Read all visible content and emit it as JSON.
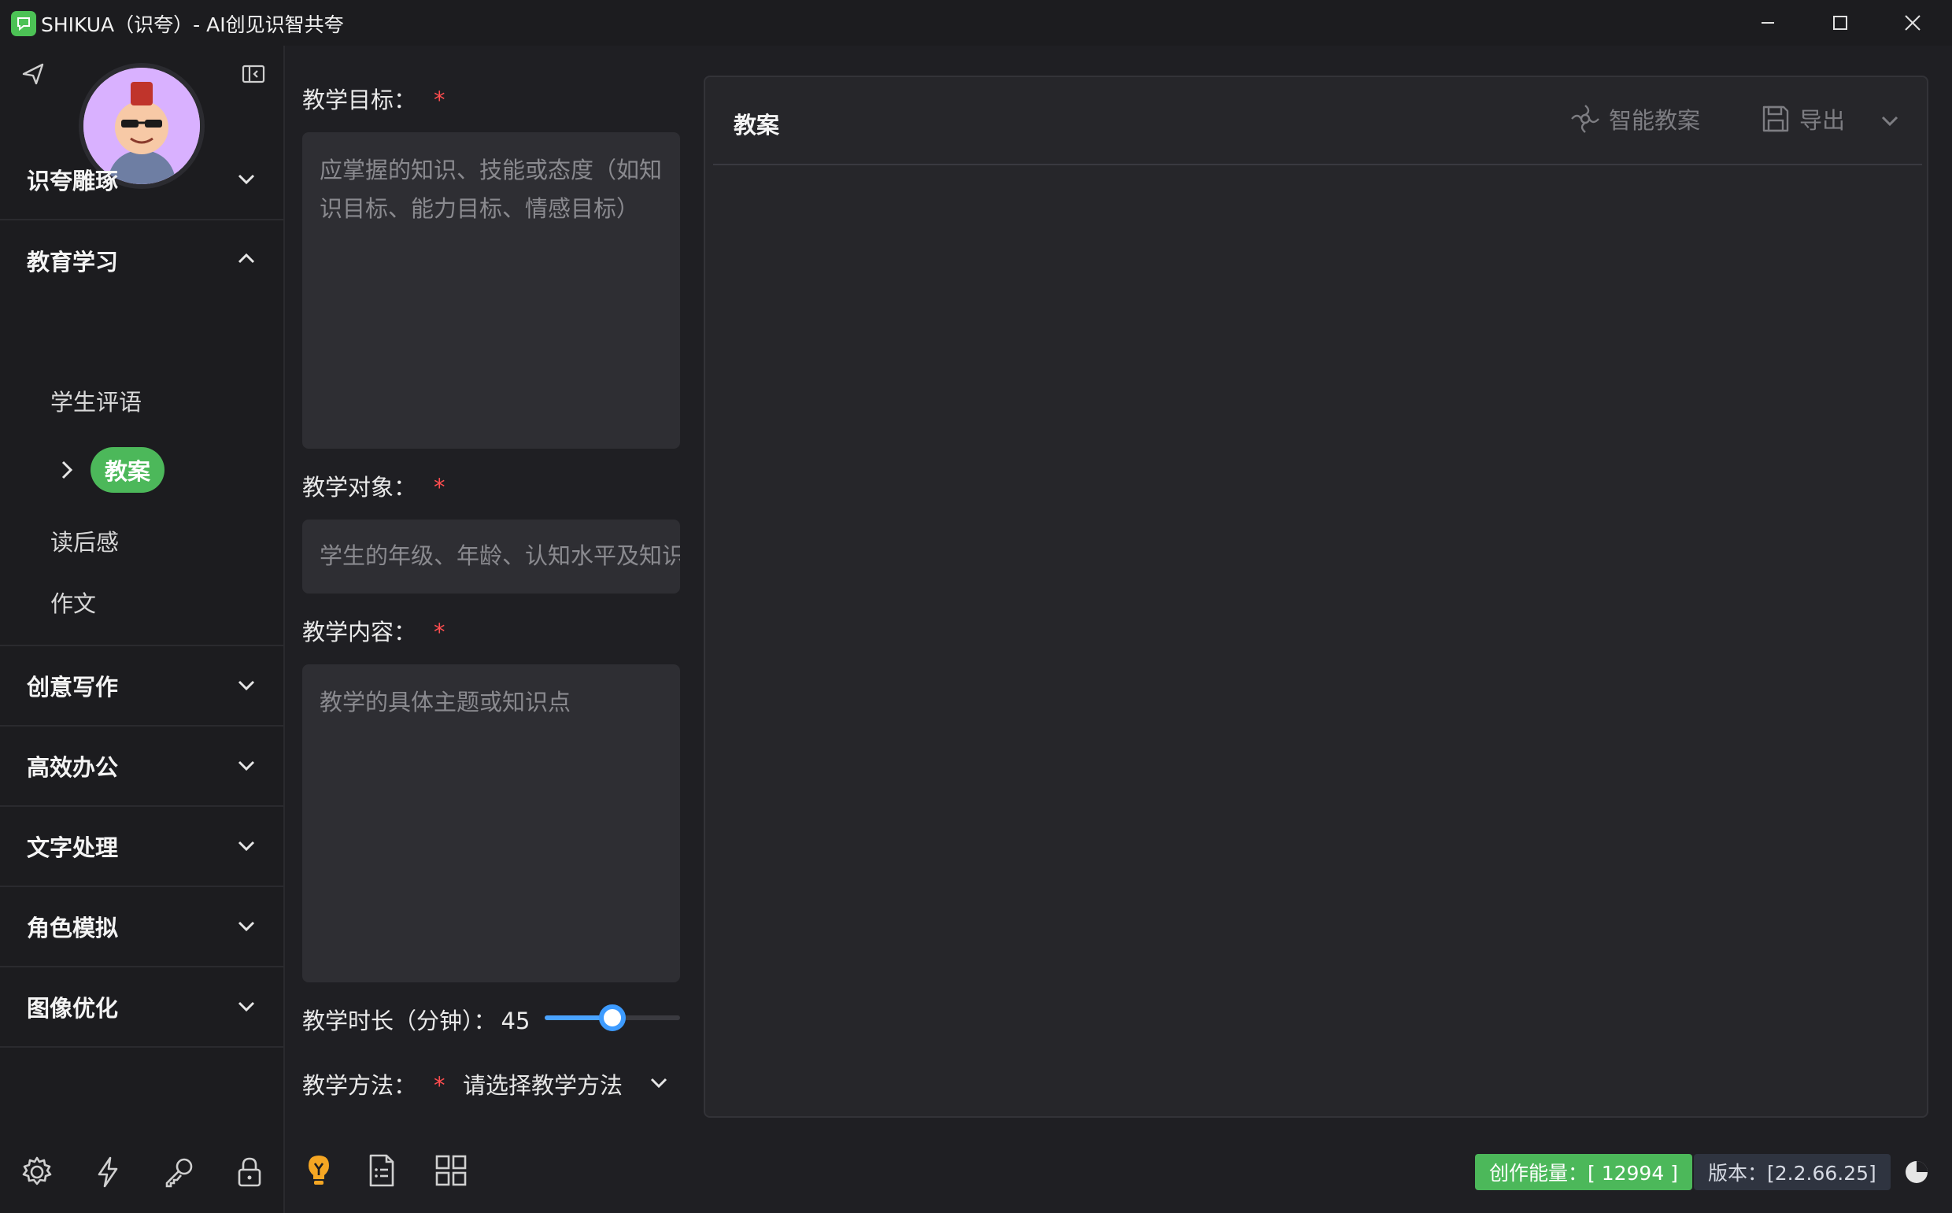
{
  "window": {
    "title": "SHIKUA（识夸）- AI创见识智共夸",
    "minimize": "minimize-icon",
    "maximize": "maximize-icon",
    "close": "close-icon"
  },
  "sidebar": {
    "groups": [
      {
        "label": "识夸雕琢",
        "expanded": false
      },
      {
        "label": "教育学习",
        "expanded": true
      },
      {
        "label": "创意写作",
        "expanded": false
      },
      {
        "label": "高效办公",
        "expanded": false
      },
      {
        "label": "文字处理",
        "expanded": false
      },
      {
        "label": "角色模拟",
        "expanded": false
      },
      {
        "label": "图像优化",
        "expanded": false
      }
    ],
    "education_items": [
      "学生评语",
      "教案",
      "读后感",
      "作文"
    ],
    "active_item": "教案",
    "bottom_icons": [
      "gear-icon",
      "lightning-icon",
      "key-icon",
      "lock-icon"
    ]
  },
  "form": {
    "objective": {
      "label": "教学目标：",
      "required": "*",
      "placeholder": "应掌握的知识、技能或态度（如知识目标、能力目标、情感目标）"
    },
    "audience": {
      "label": "教学对象：",
      "required": "*",
      "placeholder": "学生的年级、年龄、认知水平及知识"
    },
    "content": {
      "label": "教学内容：",
      "required": "*",
      "placeholder": "教学的具体主题或知识点"
    },
    "duration": {
      "label": "教学时长（分钟）：",
      "value": "45",
      "min": 0,
      "max": 90,
      "fraction": 0.5
    },
    "method": {
      "label": "教学方法：",
      "required": "*",
      "placeholder": "请选择教学方法"
    },
    "toolbar_icons": [
      "lightbulb-icon",
      "document-list-icon",
      "grid-icon"
    ]
  },
  "panel": {
    "title": "教案",
    "smart_button": "智能教案",
    "export_button": "导出"
  },
  "status": {
    "energy": "创作能量：[ 12994 ]",
    "version": "版本：[2.2.66.25]"
  },
  "colors": {
    "accent_green": "#4cb85a",
    "required_red": "#ff4d4f",
    "slider_blue": "#3d9bff",
    "bulb_yellow": "#f5a623"
  }
}
